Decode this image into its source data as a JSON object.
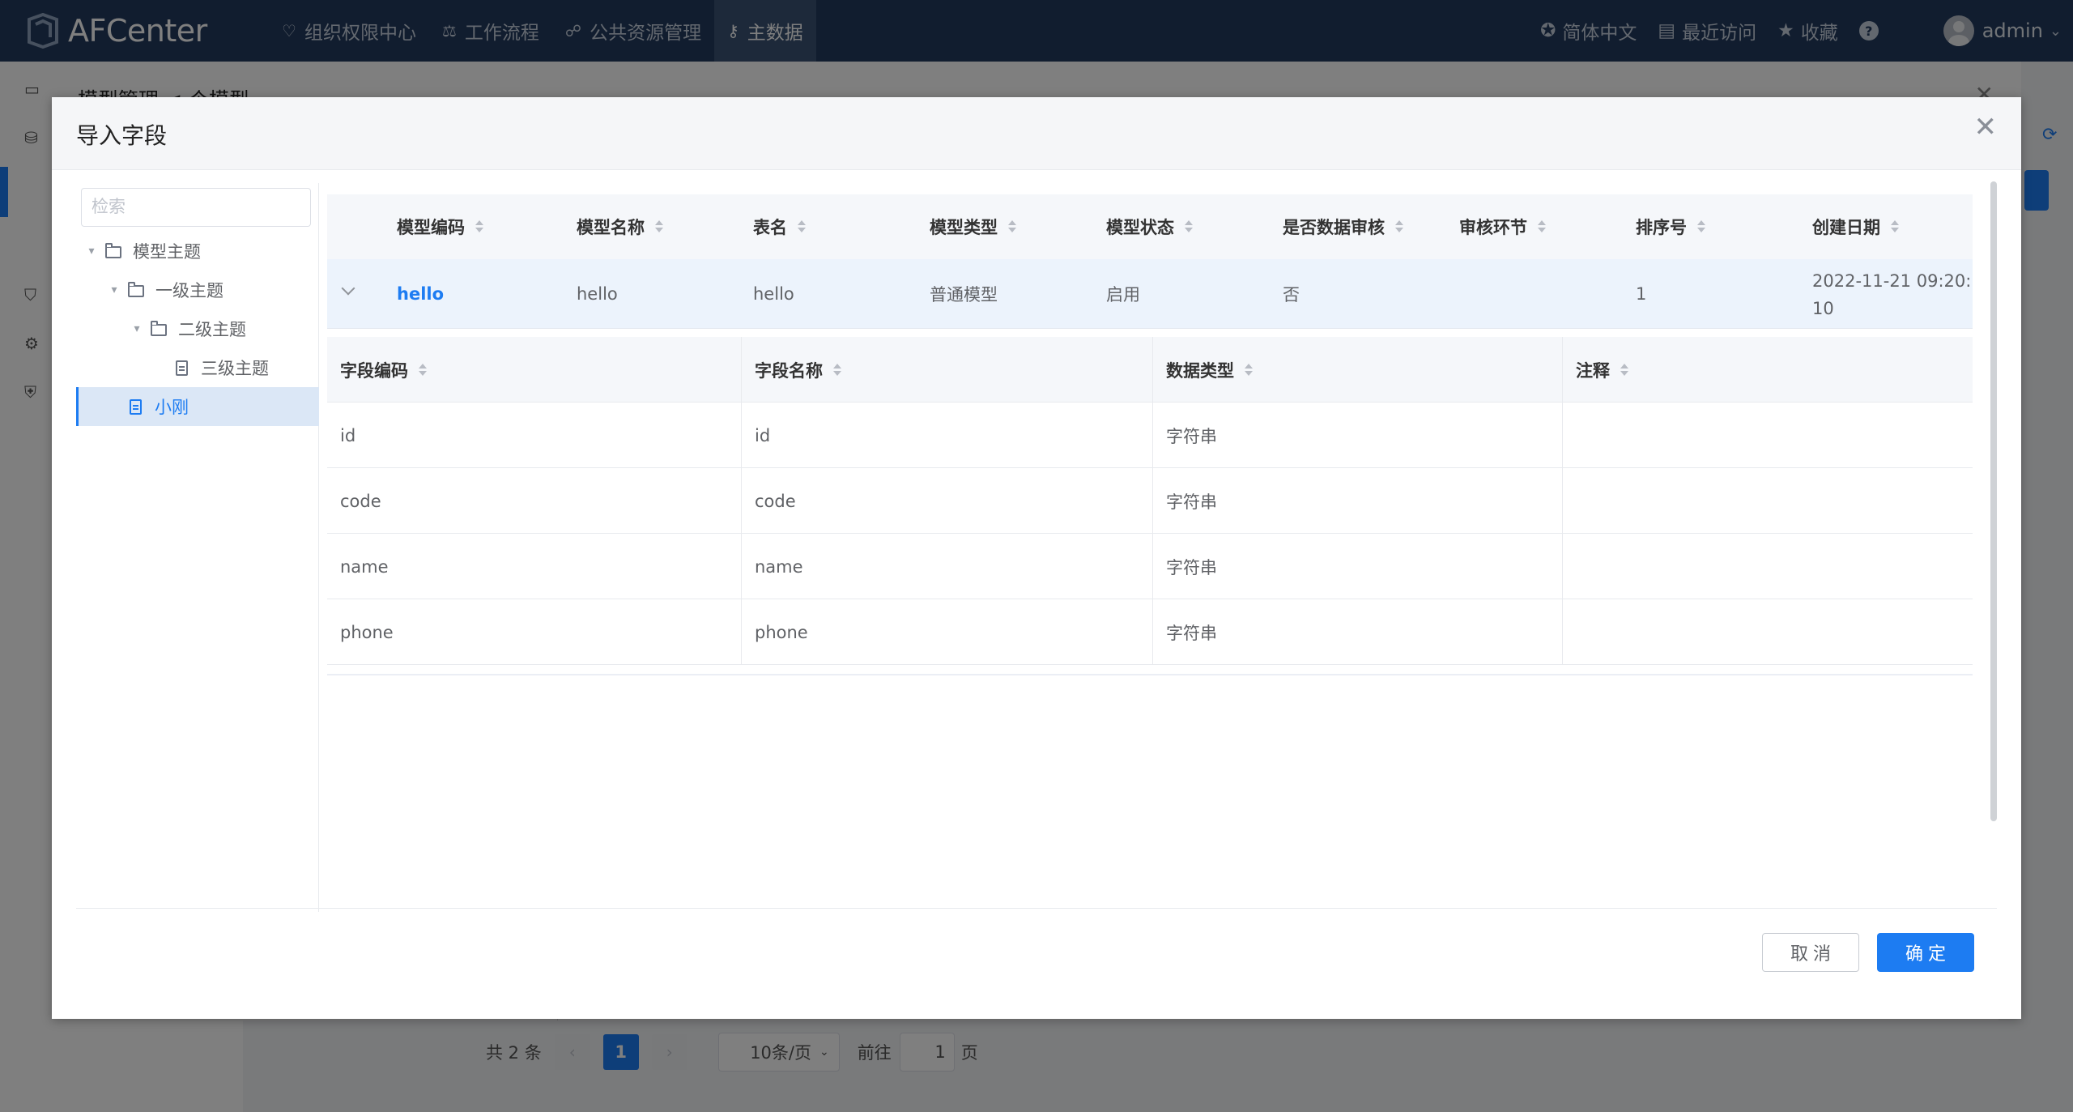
{
  "app": {
    "logo_text": "AFCenter",
    "nav": [
      {
        "label": "组织权限中心",
        "icon": "shield-icon"
      },
      {
        "label": "工作流程",
        "icon": "scale-icon"
      },
      {
        "label": "公共资源管理",
        "icon": "group-icon"
      },
      {
        "label": "主数据",
        "icon": "key-icon",
        "active": true
      }
    ],
    "top_right": {
      "language": "简体中文",
      "recent": "最近访问",
      "favorites": "收藏",
      "help": "?",
      "user": "admin"
    }
  },
  "background_page": {
    "dialog_title": "模型管理 < 个模型",
    "pager": {
      "total": "共 2 条",
      "current_page": "1",
      "page_size": "10条/页",
      "goto_label": "前往",
      "goto_value": "1",
      "page_suffix": "页"
    }
  },
  "dialog": {
    "title": "导入字段",
    "search_placeholder": "检索",
    "tree": [
      {
        "label": "模型主题",
        "level": 0,
        "type": "folder"
      },
      {
        "label": "一级主题",
        "level": 1,
        "type": "folder"
      },
      {
        "label": "二级主题",
        "level": 2,
        "type": "folder"
      },
      {
        "label": "三级主题",
        "level": 3,
        "type": "file"
      },
      {
        "label": "小刚",
        "level": 1,
        "type": "file",
        "selected": true
      }
    ],
    "model_table": {
      "columns": [
        "模型编码",
        "模型名称",
        "表名",
        "模型类型",
        "模型状态",
        "是否数据审核",
        "审核环节",
        "排序号",
        "创建日期"
      ],
      "rows": [
        {
          "code": "hello",
          "name": "hello",
          "table": "hello",
          "type": "普通模型",
          "status": "启用",
          "audit": "否",
          "audit_step": "",
          "order": "1",
          "created_line1": "2022-11-21 09:20:",
          "created_line2": "10"
        }
      ]
    },
    "field_table": {
      "columns": [
        "字段编码",
        "字段名称",
        "数据类型",
        "注释"
      ],
      "rows": [
        [
          "id",
          "id",
          "字符串",
          ""
        ],
        [
          "code",
          "code",
          "字符串",
          ""
        ],
        [
          "name",
          "name",
          "字符串",
          ""
        ],
        [
          "phone",
          "phone",
          "字符串",
          ""
        ]
      ]
    },
    "cancel_label": "取 消",
    "ok_label": "确 定"
  }
}
